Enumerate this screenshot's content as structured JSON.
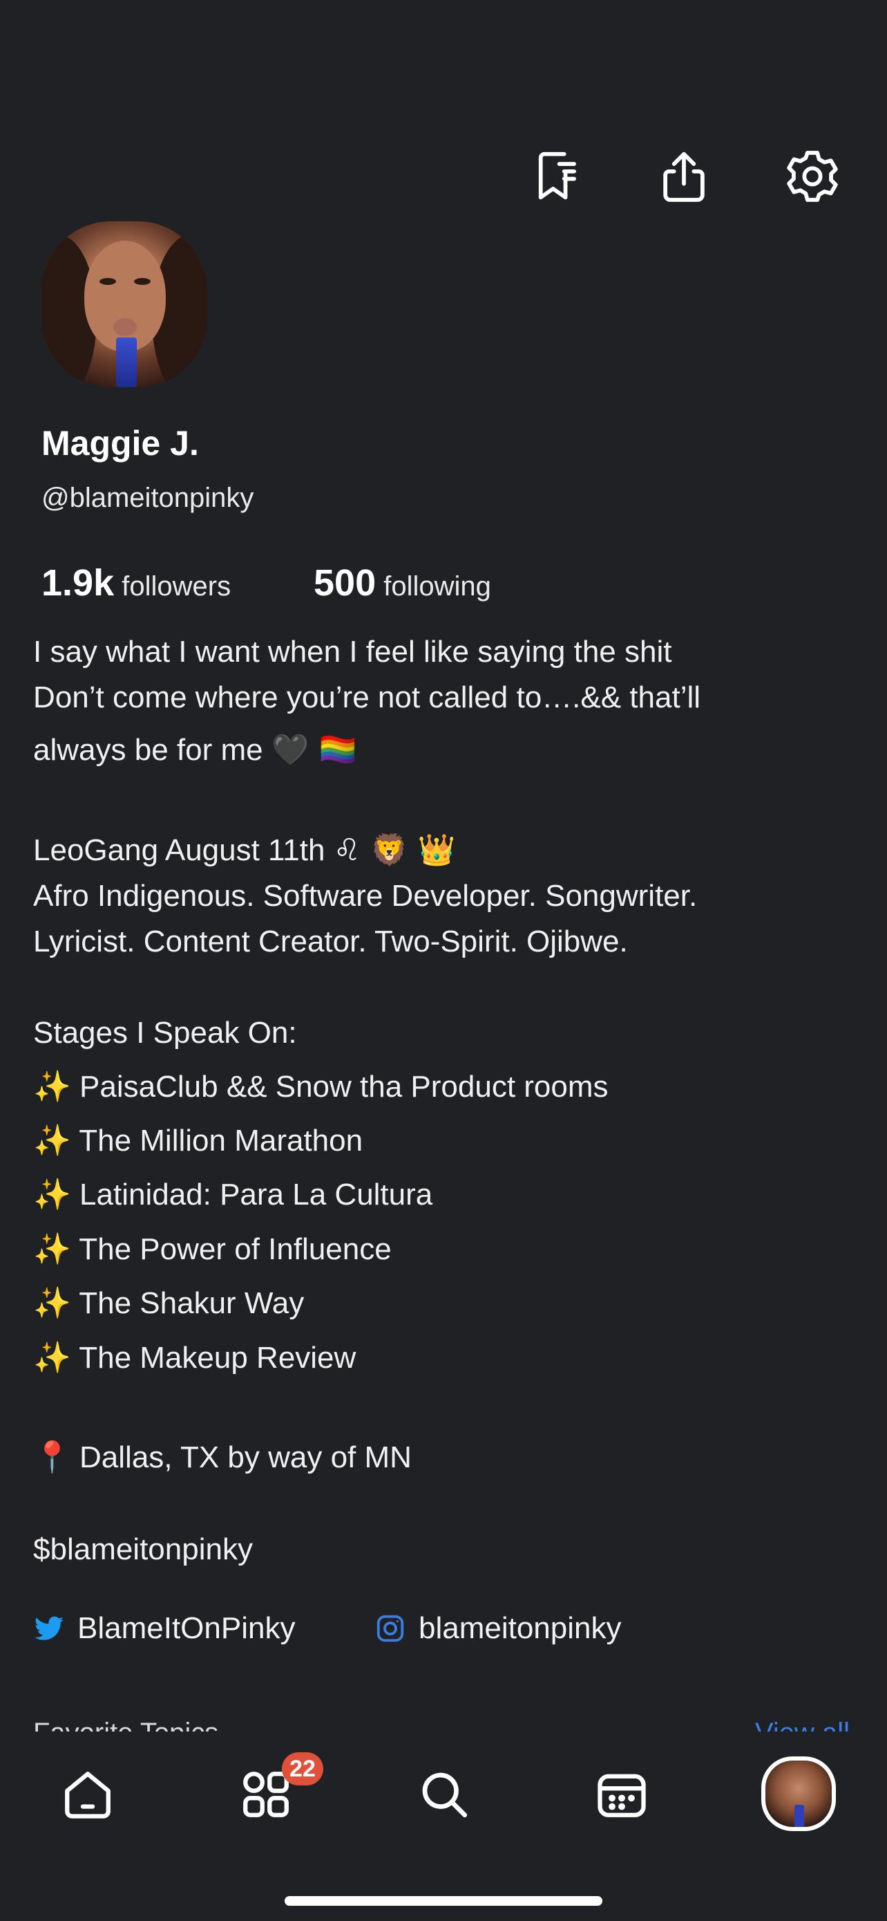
{
  "top_actions": {
    "icons": [
      "bookmark-list-icon",
      "share-icon",
      "settings-icon"
    ]
  },
  "profile": {
    "name": "Maggie J.",
    "handle": "@blameitonpinky",
    "followers_count": "1.9k",
    "followers_label": "followers",
    "following_count": "500",
    "following_label": "following"
  },
  "bio": {
    "line1": "I say what I want when I feel like saying the shit",
    "line2": "Don’t come where you’re not called to….&& that’ll",
    "line3_text": "always be for me",
    "line3_emoji": "🖤 🏳️‍🌈",
    "line4_text": "LeoGang August 11th",
    "line4_emoji": "♌ 🦁 👑",
    "line5": "Afro Indigenous. Software Developer. Songwriter.",
    "line6": "Lyricist. Content Creator. Two-Spirit. Ojibwe.",
    "stages_heading": "Stages I Speak On:",
    "sparkle": "✨",
    "stages": [
      "PaisaClub && Snow tha Product rooms",
      "The Million Marathon",
      "Latinidad: Para La Cultura",
      "The Power of Influence",
      "The Shakur Way",
      "The Makeup Review"
    ],
    "location_pin": "📍",
    "location": "Dallas, TX by way of MN",
    "cashtag": "$blameitonpinky"
  },
  "socials": {
    "twitter": "BlameItOnPinky",
    "instagram": "blameitonpinky"
  },
  "section_peek": {
    "label": "Favorite Topics",
    "view_all": "View all"
  },
  "nav": {
    "items": [
      "home-icon",
      "apps-icon",
      "search-icon",
      "calendar-icon",
      "profile-avatar"
    ],
    "badge_count": "22"
  },
  "colors": {
    "background": "#202124",
    "accent_blue": "#3b7de0",
    "badge": "#e0513a",
    "twitter": "#1d9bf0"
  }
}
